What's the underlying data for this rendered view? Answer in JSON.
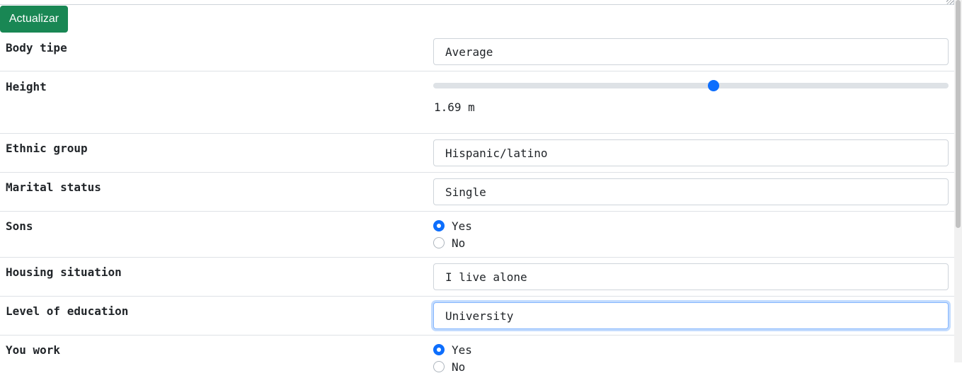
{
  "update_button": "Actualizar",
  "fields": {
    "body_type": {
      "label": "Body tipe",
      "value": "Average"
    },
    "height": {
      "label": "Height",
      "value_text": "1.69 m",
      "slider_fraction": 0.545
    },
    "ethnic_group": {
      "label": "Ethnic group",
      "value": "Hispanic/latino"
    },
    "marital_status": {
      "label": "Marital status",
      "value": "Single"
    },
    "sons": {
      "label": "Sons",
      "options": [
        "Yes",
        "No"
      ],
      "selected": "Yes"
    },
    "housing": {
      "label": "Housing situation",
      "value": "I live alone"
    },
    "education": {
      "label": "Level of education",
      "value": "University"
    },
    "work": {
      "label": "You work",
      "options": [
        "Yes",
        "No"
      ],
      "selected": "Yes"
    }
  },
  "colors": {
    "accent": "#0d6efd",
    "button": "#198754"
  }
}
